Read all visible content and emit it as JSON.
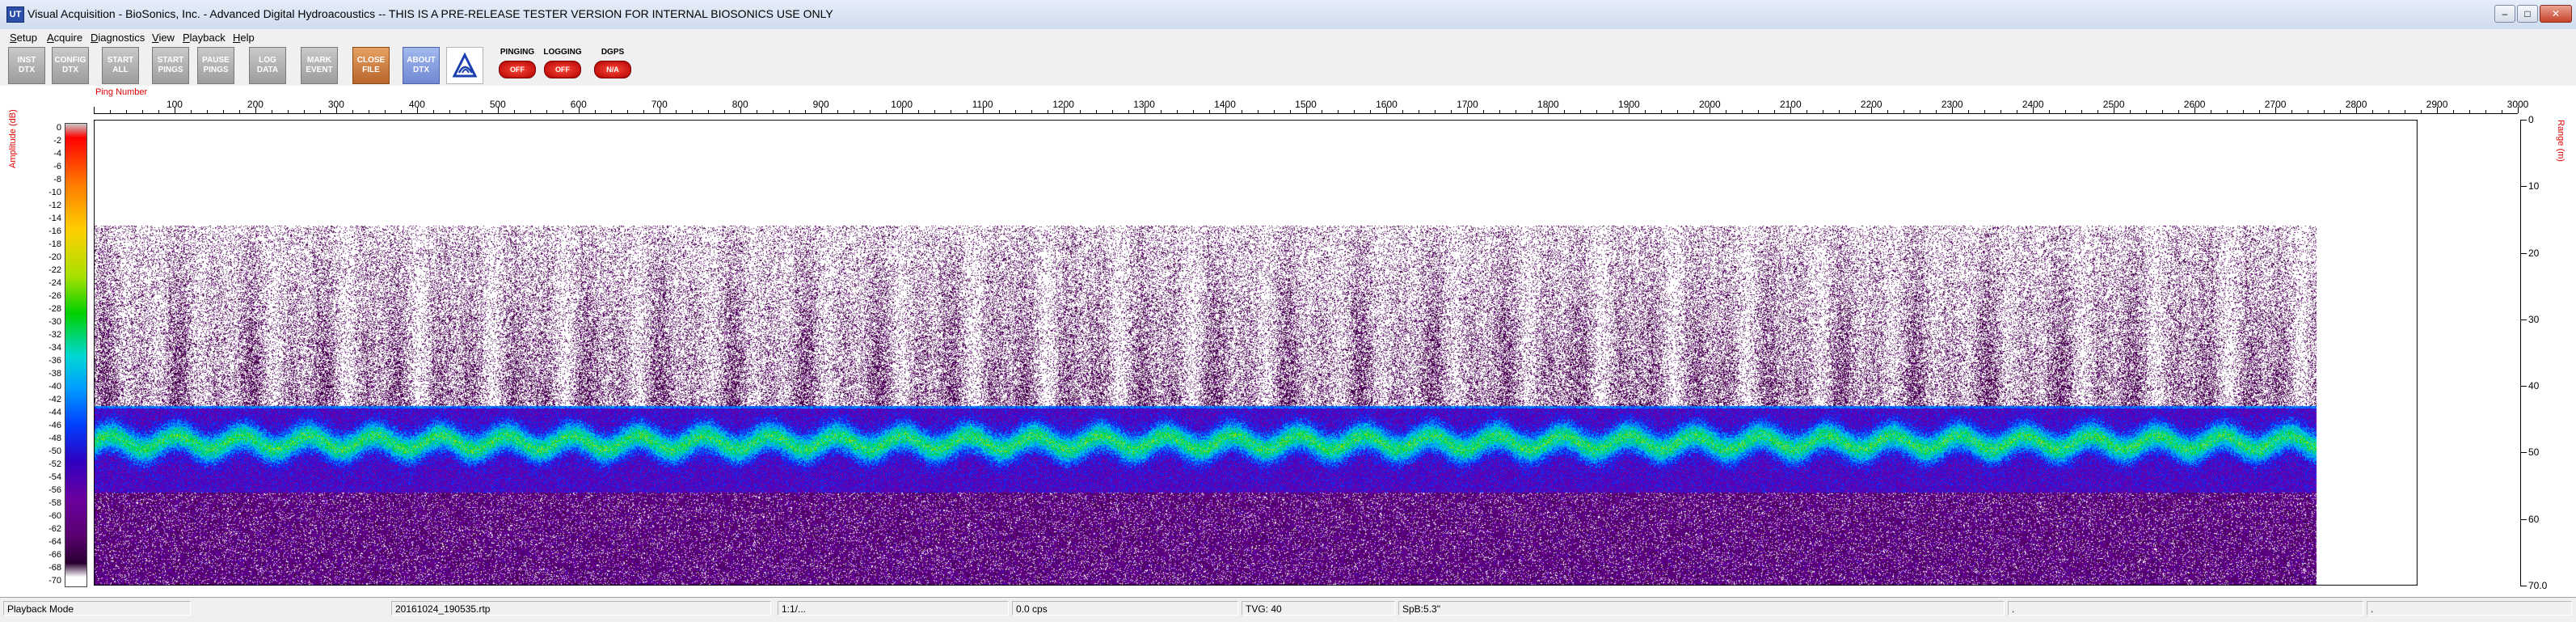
{
  "window": {
    "app_icon": "UT",
    "title": "Visual Acquisition  - BioSonics, Inc.  - Advanced Digital Hydroacoustics  -- THIS IS A PRE-RELEASE TESTER VERSION FOR INTERNAL BIOSONICS USE ONLY",
    "minimize_icon": "minimize-icon",
    "maximize_icon": "maximize-icon",
    "close_icon": "close-icon"
  },
  "menu": [
    {
      "label": "Setup",
      "u": "S"
    },
    {
      "label": "Acquire",
      "u": "A"
    },
    {
      "label": "Diagnostics",
      "u": "D"
    },
    {
      "label": "View",
      "u": "V"
    },
    {
      "label": "Playback",
      "u": "P"
    },
    {
      "label": "Help",
      "u": "H"
    }
  ],
  "toolbar": {
    "inst_dtx": [
      "INST",
      "DTX"
    ],
    "config_dtx": [
      "CONFIG",
      "DTX"
    ],
    "start_all": [
      "START",
      "ALL"
    ],
    "start_pings": [
      "START",
      "PINGS"
    ],
    "pause_pings": [
      "PAUSE",
      "PINGS"
    ],
    "log_data": [
      "LOG",
      "DATA"
    ],
    "mark_event": [
      "MARK",
      "EVENT"
    ],
    "close_file": [
      "CLOSE",
      "FILE"
    ],
    "about_dtx": [
      "ABOUT",
      "DTX"
    ],
    "logo_icon": "biosonics-logo-icon",
    "pinging": {
      "label": "PINGING",
      "state": "OFF"
    },
    "logging": {
      "label": "LOGGING",
      "state": "OFF"
    },
    "dgps": {
      "label": "DGPS",
      "state": "N/A"
    }
  },
  "echogram": {
    "ping_axis_title": "Ping Number",
    "amplitude_axis_title": "Amplitude (dB)",
    "range_axis_title": "Range (m)"
  },
  "chart_data": {
    "type": "heatmap",
    "title": "",
    "xlabel": "Ping Number",
    "ylabel": "Range (m)",
    "x_ticks": [
      100,
      200,
      300,
      400,
      500,
      600,
      700,
      800,
      900,
      1000,
      1100,
      1200,
      1300,
      1400,
      1500,
      1600,
      1700,
      1800,
      1900,
      2000,
      2100,
      2200,
      2300,
      2400,
      2500,
      2600,
      2700,
      2800,
      2900,
      3000
    ],
    "xlim": [
      0,
      3000
    ],
    "y_ticks": [
      "0",
      "10",
      "20",
      "30",
      "40",
      "50",
      "60",
      "70.0"
    ],
    "ylim": [
      0,
      70
    ],
    "colorbar": {
      "label": "Amplitude (dB)",
      "ticks": [
        0,
        -2,
        -4,
        -6,
        -8,
        -10,
        -12,
        -14,
        -16,
        -18,
        -20,
        -22,
        -24,
        -26,
        -28,
        -30,
        -32,
        -34,
        -36,
        -38,
        -40,
        -42,
        -44,
        -46,
        -48,
        -50,
        -52,
        -54,
        -56,
        -58,
        -60,
        -62,
        -64,
        -66,
        -68,
        -70
      ],
      "range": [
        -70,
        0
      ]
    },
    "data_extent_pings": 2870,
    "layers": [
      {
        "from_m": 0,
        "to_m": 16,
        "level": "no signal"
      },
      {
        "from_m": 16,
        "to_m": 43,
        "level": "sparse weak scatter (-60 to -70 dB)"
      },
      {
        "from_m": 43,
        "to_m": 44,
        "level": "surface/bottom line (-40 to -44 dB)"
      },
      {
        "from_m": 44,
        "to_m": 56,
        "level": "strong returns (-30 to -50 dB)"
      },
      {
        "from_m": 56,
        "to_m": 70,
        "level": "dense weak returns (-56 to -70 dB)"
      }
    ]
  },
  "status": {
    "mode": "Playback Mode",
    "file": "20161024_190535.rtp",
    "ratio": "1:1/...",
    "rate": "0.0 cps",
    "tvg": "TVG: 40",
    "spb": "SpB:5.3\"",
    "blank1": ".",
    "blank2": "."
  }
}
